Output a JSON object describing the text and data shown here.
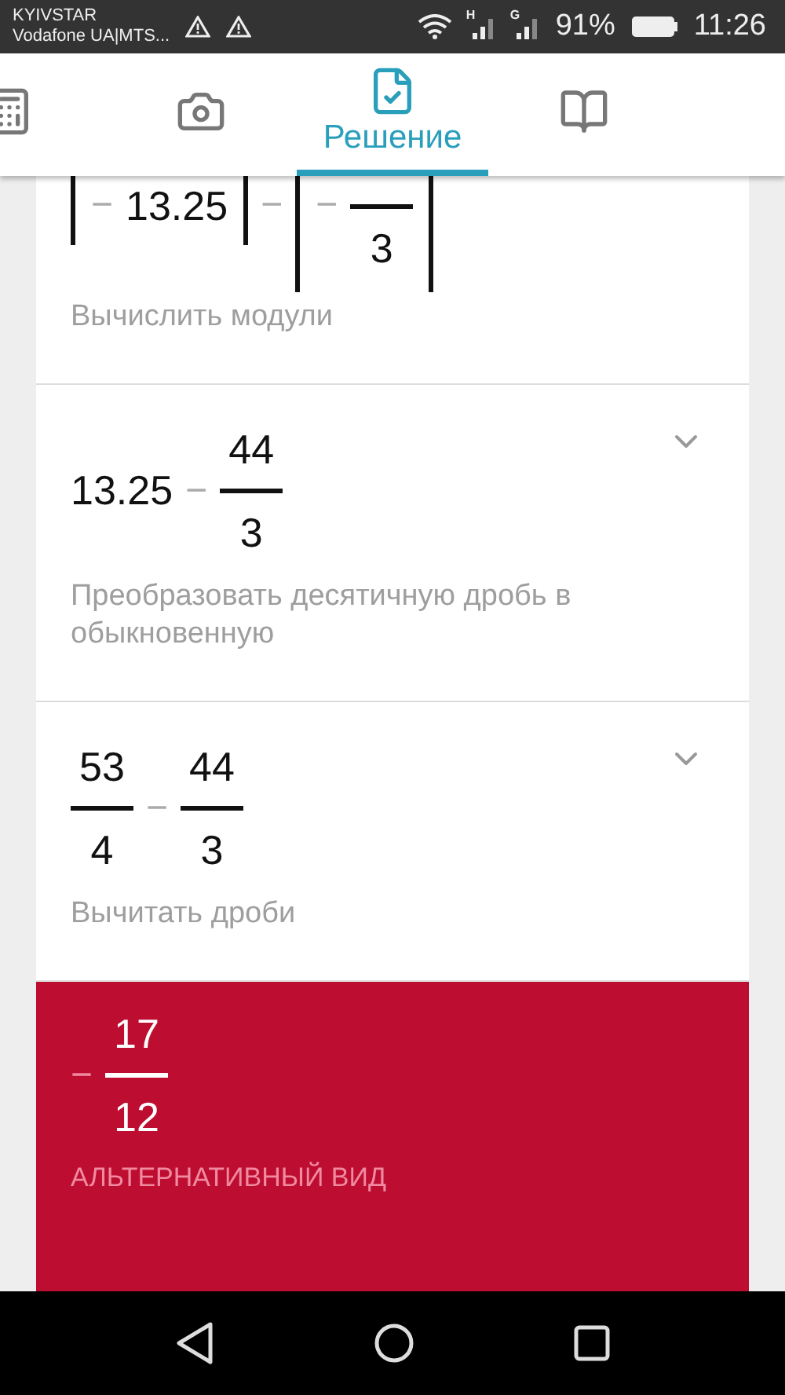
{
  "status_bar": {
    "carriers": [
      "KYIVSTAR",
      "Vodafone UA|MTS..."
    ],
    "network_labels": [
      "H",
      "G"
    ],
    "battery": "91%",
    "time": "11:26"
  },
  "tabs": [
    {
      "kind": "calculator",
      "selected": false
    },
    {
      "kind": "camera",
      "selected": false
    },
    {
      "kind": "solution",
      "label": "Решение",
      "selected": true
    },
    {
      "kind": "book",
      "selected": false
    }
  ],
  "steps": [
    {
      "expression": [
        {
          "kind": "abs",
          "content": [
            {
              "kind": "op",
              "text": "−"
            },
            {
              "kind": "number",
              "text": "13.25"
            }
          ]
        },
        {
          "kind": "op",
          "text": "−"
        },
        {
          "kind": "abs",
          "content": [
            {
              "kind": "op",
              "text": "−"
            },
            {
              "kind": "fraction",
              "den": "3"
            }
          ]
        }
      ],
      "caption": "Вычислить модули"
    },
    {
      "expanded": false,
      "expression": [
        {
          "kind": "number",
          "text": "13.25"
        },
        {
          "kind": "op",
          "text": "−"
        },
        {
          "kind": "fraction",
          "num": "44",
          "den": "3"
        }
      ],
      "caption": "Преобразовать десятичную дробь в обыкновенную"
    },
    {
      "expanded": false,
      "expression": [
        {
          "kind": "fraction",
          "num": "53",
          "den": "4"
        },
        {
          "kind": "op",
          "text": "−"
        },
        {
          "kind": "fraction",
          "num": "44",
          "den": "3"
        }
      ],
      "caption": "Вычитать дроби"
    }
  ],
  "result": {
    "expression": [
      {
        "kind": "op",
        "text": "−"
      },
      {
        "kind": "fraction",
        "num": "17",
        "den": "12"
      }
    ],
    "label": "АЛЬТЕРНАТИВНЫЙ ВИД"
  }
}
